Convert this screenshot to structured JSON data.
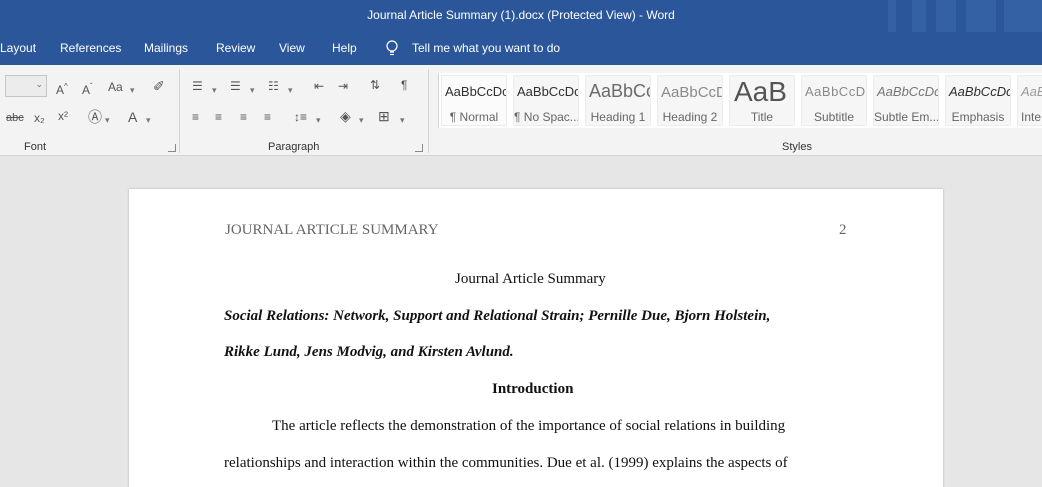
{
  "window": {
    "title": "Journal Article Summary (1).docx (Protected View)  -  Word"
  },
  "menu": {
    "items": [
      "Layout",
      "References",
      "Mailings",
      "Review",
      "View",
      "Help"
    ],
    "tell_me": "Tell me what you want to do"
  },
  "ribbon": {
    "groups": {
      "font": "Font",
      "paragraph": "Paragraph",
      "styles": "Styles"
    },
    "styles": [
      {
        "preview": "AaBbCcDc",
        "name": "¶ Normal"
      },
      {
        "preview": "AaBbCcDc",
        "name": "¶ No Spac..."
      },
      {
        "preview": "AaBbCc",
        "name": "Heading 1"
      },
      {
        "preview": "AaBbCcD",
        "name": "Heading 2"
      },
      {
        "preview": "AaB",
        "name": "Title"
      },
      {
        "preview": "AaBbCcD",
        "name": "Subtitle"
      },
      {
        "preview": "AaBbCcDc",
        "name": "Subtle Em..."
      },
      {
        "preview": "AaBbCcDc",
        "name": "Emphasis"
      },
      {
        "preview": "AaBb",
        "name": "Inte"
      }
    ],
    "icons": [
      "grow-font-icon",
      "shrink-font-icon",
      "change-case-icon",
      "clear-formatting-icon",
      "strikethrough-icon",
      "subscript-icon",
      "superscript-icon",
      "text-effects-icon",
      "font-color-icon",
      "bullets-icon",
      "numbering-icon",
      "multilevel-list-icon",
      "decrease-indent-icon",
      "increase-indent-icon",
      "sort-icon",
      "show-marks-icon",
      "align-left-icon",
      "center-icon",
      "align-right-icon",
      "justify-icon",
      "line-spacing-icon",
      "shading-icon",
      "borders-icon"
    ]
  },
  "document": {
    "running_head": "JOURNAL ARTICLE SUMMARY",
    "page_number": "2",
    "title": "Journal Article Summary",
    "citation_line1": "Social Relations: Network, Support and Relational Strain; Pernille Due, Bjorn Holstein,",
    "citation_line2": "Rikke Lund, Jens Modvig, and Kirsten Avlund.",
    "heading": "Introduction",
    "body_line1": "The article reflects the demonstration of the importance of social relations in building",
    "body_line2": "relationships and interaction within the communities. Due et al. (1999) explains the aspects of"
  },
  "colors": {
    "title_bar": "#2b579a",
    "ribbon_bg": "#f3f3f3",
    "canvas_bg": "#e6e6e6",
    "page_bg": "#ffffff"
  }
}
